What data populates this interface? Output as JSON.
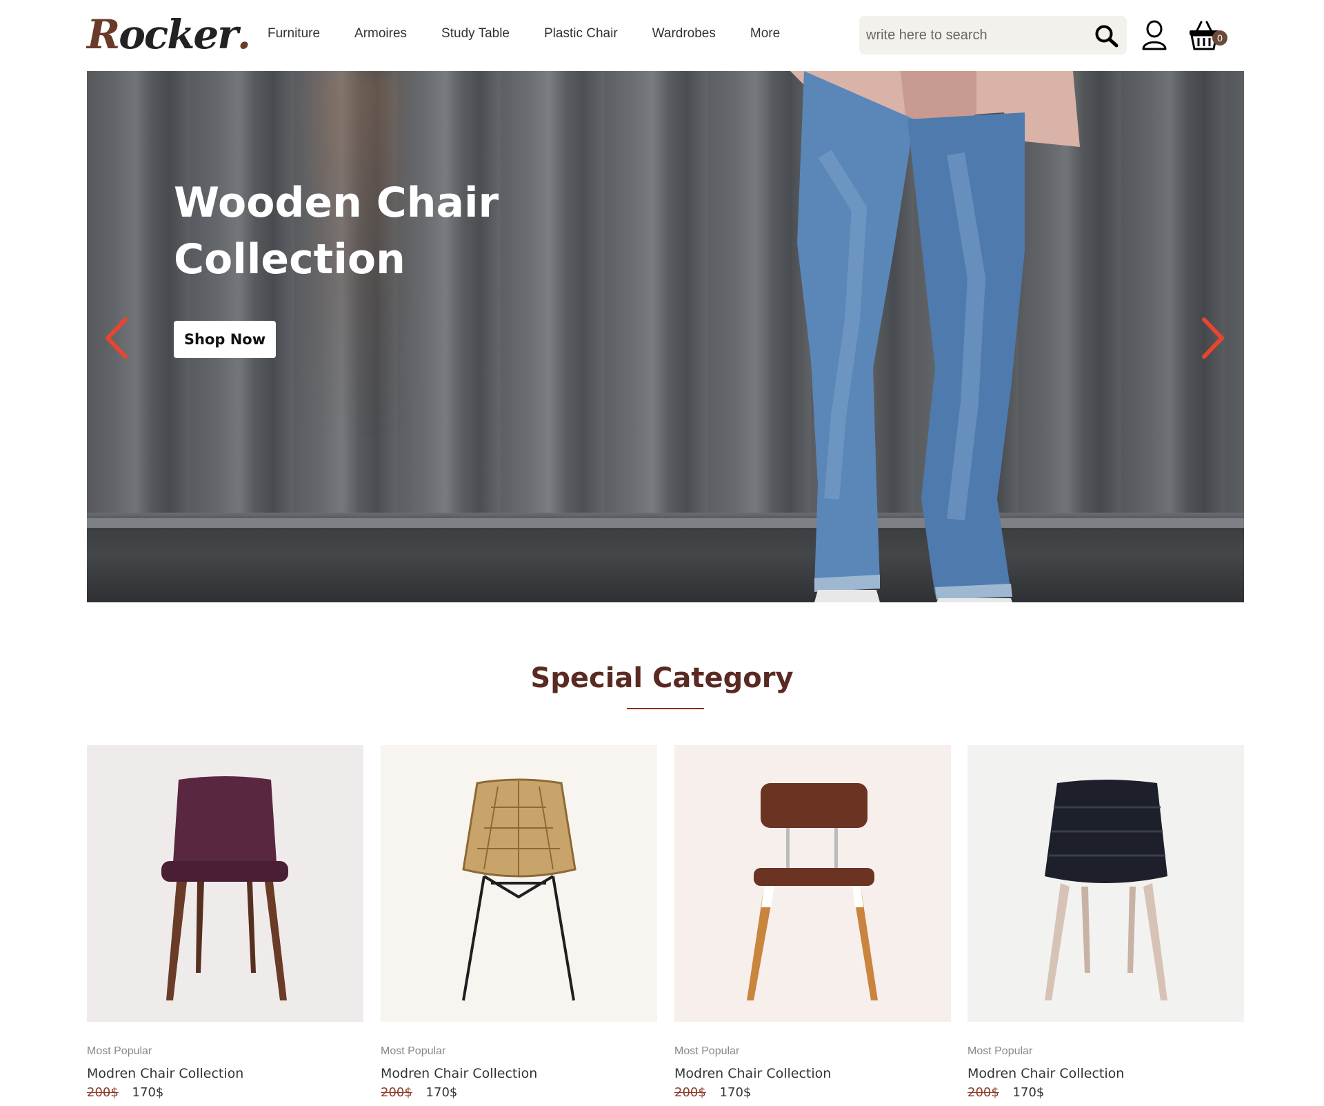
{
  "brand": {
    "logo_text": "Rocker",
    "logo_cap": "R",
    "logo_rest": "ocker",
    "logo_dot": ".",
    "accent": "#6b3b2a"
  },
  "nav": {
    "items": [
      {
        "label": "Furniture"
      },
      {
        "label": "Armoires"
      },
      {
        "label": "Study Table"
      },
      {
        "label": "Plastic Chair"
      },
      {
        "label": "Wardrobes"
      },
      {
        "label": "More"
      }
    ]
  },
  "search": {
    "placeholder": "write here to search",
    "icon": "search-icon"
  },
  "account": {
    "icon": "user-icon"
  },
  "cart": {
    "icon": "basket-icon",
    "count": "0"
  },
  "hero": {
    "title_line1": "Wooden Chair",
    "title_line2": "Collection",
    "cta_label": "Shop Now",
    "prev_icon": "chevron-left-icon",
    "next_icon": "chevron-right-icon",
    "arrow_color": "#e8452f"
  },
  "special": {
    "title": "Special Category",
    "products": [
      {
        "tag": "Most Popular",
        "name": "Modren Chair Collection",
        "old_price": "200$",
        "price": "170$",
        "bg": "#f0ebeb",
        "seat_color": "#5a2740",
        "leg_color": "#6a3b26"
      },
      {
        "tag": "Most Popular",
        "name": "Modren Chair Collection",
        "old_price": "200$",
        "price": "170$",
        "bg": "#f8f4f0",
        "seat_color": "#b8935a",
        "leg_color": "#1f1f1f"
      },
      {
        "tag": "Most Popular",
        "name": "Modren Chair Collection",
        "old_price": "200$",
        "price": "170$",
        "bg": "#f6efec",
        "seat_color": "#6b3322",
        "leg_color": "#c9843e"
      },
      {
        "tag": "Most Popular",
        "name": "Modren Chair Collection",
        "old_price": "200$",
        "price": "170$",
        "bg": "#f2f2f0",
        "seat_color": "#1d1f2a",
        "leg_color": "#d7c3b6"
      }
    ]
  }
}
